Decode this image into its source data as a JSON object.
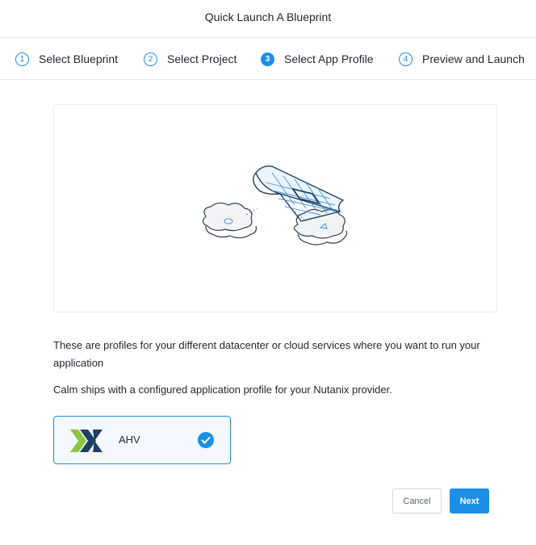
{
  "header": {
    "title": "Quick Launch A Blueprint"
  },
  "steps": [
    {
      "number": "1",
      "label": "Select Blueprint",
      "active": false
    },
    {
      "number": "2",
      "label": "Select Project",
      "active": false
    },
    {
      "number": "3",
      "label": "Select App Profile",
      "active": true
    },
    {
      "number": "4",
      "label": "Preview and Launch",
      "active": false
    }
  ],
  "main": {
    "description": "These are profiles for your different datacenter or cloud services where you want to run your application",
    "note": "Calm ships with a configured application profile for your Nutanix provider."
  },
  "profiles": [
    {
      "name": "AHV",
      "selected": true,
      "logo_icon": "nutanix-logo"
    }
  ],
  "actions": {
    "cancel_label": "Cancel",
    "next_label": "Next"
  },
  "colors": {
    "accent": "#1b8fe6",
    "selected_bg": "#f2f8fd",
    "border": "#e6e8eb"
  }
}
